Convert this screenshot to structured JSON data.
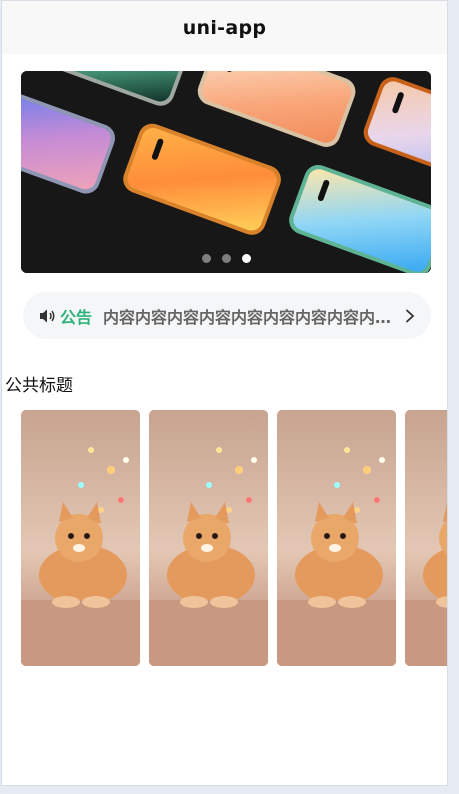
{
  "navbar": {
    "title": "uni-app"
  },
  "banner": {
    "slides": [
      "slide-1",
      "slide-2",
      "slide-3"
    ],
    "active_index": 2
  },
  "notice": {
    "icon": "speaker-icon",
    "tag": "公告",
    "text": "内容内容内容内容内容内容内容内容内容内容",
    "arrow_icon": "chevron-right-icon"
  },
  "section": {
    "title": "公共标题"
  },
  "cards": [
    {
      "image": "cat-photo"
    },
    {
      "image": "cat-photo"
    },
    {
      "image": "cat-photo"
    },
    {
      "image": "cat-photo"
    }
  ],
  "colors": {
    "accent": "#2fb27a",
    "navbar_bg": "#f8f8f8",
    "notice_bg": "#f5f6f7"
  }
}
